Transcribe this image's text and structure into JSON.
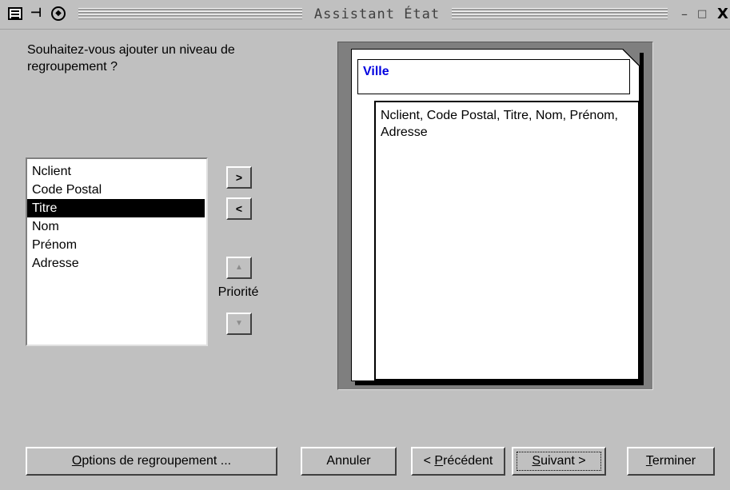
{
  "window": {
    "title": "Assistant État"
  },
  "titlebar_icons": {
    "app": "report-wizard-icon",
    "pin": "pin-icon",
    "menu": "system-menu-icon",
    "minimize": "–",
    "maximize": "□",
    "close": "X"
  },
  "question": "Souhaitez-vous ajouter un niveau de regroupement ?",
  "field_list": {
    "items": [
      "Nclient",
      "Code Postal",
      "Titre",
      "Nom",
      "Prénom",
      "Adresse"
    ],
    "selected": "Titre"
  },
  "buttons": {
    "add": ">",
    "remove": "<",
    "priority_up": "▲",
    "priority_down": "▼",
    "priority_label": "Priorité"
  },
  "preview": {
    "group_header": "Ville",
    "detail_fields": "Nclient, Code Postal, Titre, Nom, Prénom, Adresse"
  },
  "footer": {
    "grouping_options_pre": "",
    "grouping_options_accel": "O",
    "grouping_options_post": "ptions de regroupement ...",
    "cancel": "Annuler",
    "previous_pre": "< ",
    "previous_accel": "P",
    "previous_post": "récédent",
    "next_accel": "S",
    "next_post": "uivant >",
    "finish_accel": "T",
    "finish_post": "erminer"
  },
  "colors": {
    "face": "#c0c0c0",
    "selection": "#000000",
    "group_header_text": "#0000e0"
  }
}
